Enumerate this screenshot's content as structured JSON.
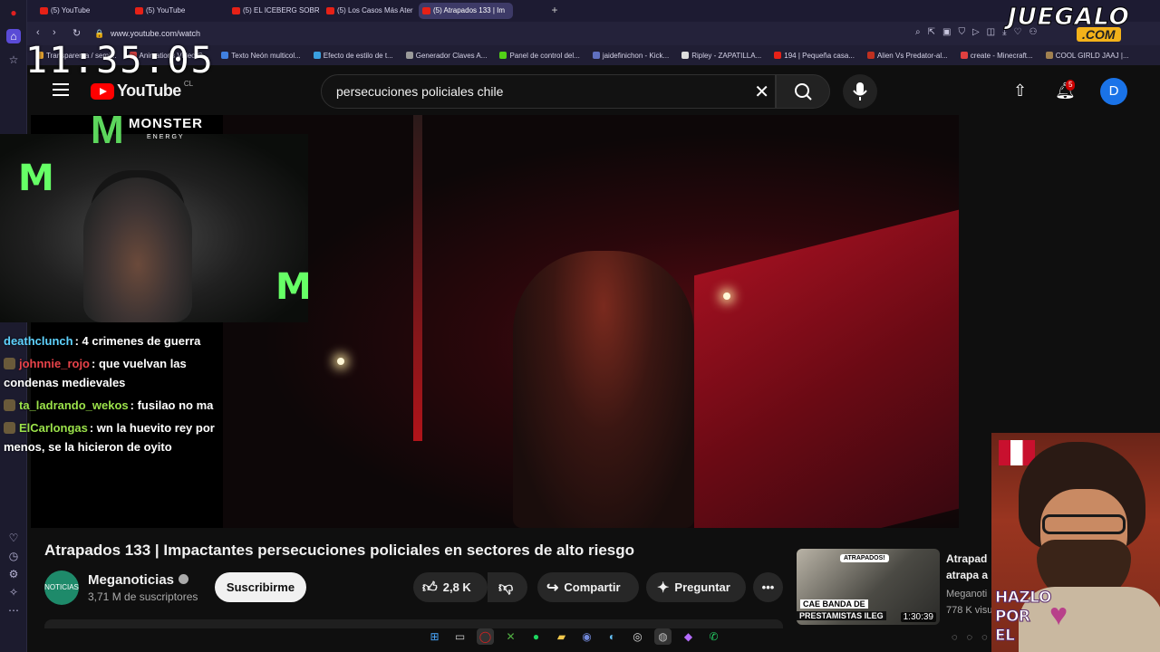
{
  "browser": {
    "tabs": [
      {
        "label": "(5) YouTube",
        "active": false
      },
      {
        "label": "(5) YouTube",
        "active": false
      },
      {
        "label": "(5) EL ICEBERG SOBRE CH",
        "active": false
      },
      {
        "label": "(5) Los Casos Más Aterrac",
        "active": false
      },
      {
        "label": "(5) Atrapados 133 | Im",
        "active": true
      }
    ],
    "url": "www.youtube.com/watch",
    "bookmarks": [
      "Transparenta / semi...",
      "Animations Video C...",
      "Texto Neón multicol...",
      "Efecto de estilo de t...",
      "Generador Claves A...",
      "Panel de control del...",
      "jaidefinichon - Kick...",
      "Ripley - ZAPATILLA...",
      "194 | Pequeña casa...",
      "Alien Vs Predator-al...",
      "create - Minecraft...",
      "COOL GIRLD JAAJ |..."
    ]
  },
  "overlay": {
    "clock": "11:35:05",
    "brand_top": "JUEGALO",
    "brand_bottom": ".COM",
    "monster_word": "MONSTER",
    "monster_sub": "ENERGY",
    "promo_line1": "HAZLO",
    "promo_line2": "POR",
    "promo_line3": "EL"
  },
  "chat": [
    {
      "user": "deathclunch",
      "text": ": 4 crimenes de guerra",
      "color": "#5fd3ff"
    },
    {
      "user": "johnnie_rojo",
      "text": ": que vuelvan las",
      "cont": "condenas medievales",
      "color": "#e8434a"
    },
    {
      "user": "ta_ladrando_wekos",
      "text": ": fusilao no ma",
      "color": "#9be24a"
    },
    {
      "user": "ElCarlongas",
      "text": ": wn la huevito rey por",
      "cont": "menos, se la hicieron de oyito",
      "color": "#9be24a"
    }
  ],
  "youtube": {
    "logo_word": "YouTube",
    "country": "CL",
    "search_query": "persecuciones policiales chile",
    "notif_count": "5",
    "avatar_letter": "D",
    "video_title": "Atrapados 133 | Impactantes persecuciones policiales en sectores de alto riesgo",
    "channel_name": "Meganoticias",
    "subscribers": "3,71 M de suscriptores",
    "subscribe_label": "Suscribirme",
    "likes": "2,8 K",
    "share_label": "Compartir",
    "ask_label": "Preguntar",
    "channel_avatar_text": "NOTICIAS"
  },
  "recommendation": {
    "title_line1": "Atrapad",
    "title_line2": "atrapa a",
    "channel": "Meganoti",
    "views": "778 K visu",
    "duration": "1:30:39",
    "thumb_tag": "ATRAPADOS!",
    "thumb_line1": "CAE BANDA DE",
    "thumb_line2": "PRESTAMISTAS ILEG"
  },
  "colors": {
    "yt_red": "#ff0000",
    "bg": "#0f0f0f",
    "brand_yellow": "#f3b21a",
    "monster_green": "#5cd65c"
  }
}
